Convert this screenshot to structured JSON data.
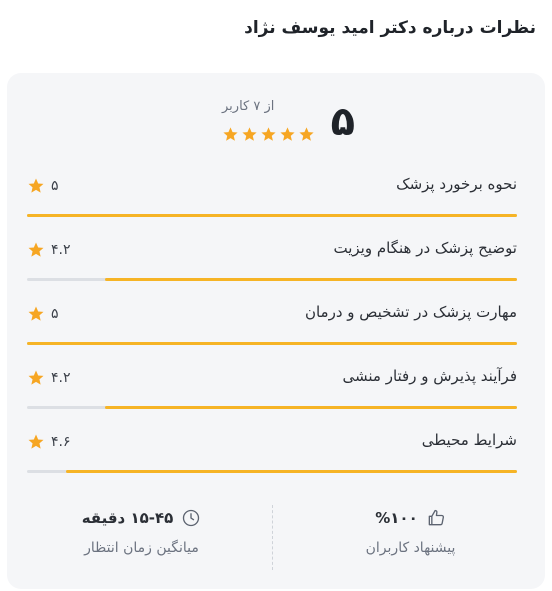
{
  "page": {
    "title": "نظرات درباره دکتر امید یوسف نژاد"
  },
  "summary": {
    "score": "۵",
    "users_text": "از ۷ کاربر",
    "stars": 5
  },
  "criteria": [
    {
      "label": "نحوه برخورد پزشک",
      "score": "۵",
      "fraction": 1.0
    },
    {
      "label": "توضیح پزشک در هنگام ویزیت",
      "score": "۴.۲",
      "fraction": 0.84
    },
    {
      "label": "مهارت پزشک در تشخیص و درمان",
      "score": "۵",
      "fraction": 1.0
    },
    {
      "label": "فرآیند پذیرش و رفتار منشی",
      "score": "۴.۲",
      "fraction": 0.84
    },
    {
      "label": "شرایط محیطی",
      "score": "۴.۶",
      "fraction": 0.92
    }
  ],
  "stats": {
    "recommend": {
      "value": "%۱۰۰",
      "label": "پیشنهاد کاربران",
      "icon": "thumbs-up-icon"
    },
    "wait_time": {
      "value": "۱۵-۴۵ دقیقه",
      "label": "میانگین زمان انتظار",
      "icon": "clock-icon"
    }
  },
  "colors": {
    "star": "#f6a623",
    "bar": "#f6b426",
    "track": "#dcdfe4"
  }
}
